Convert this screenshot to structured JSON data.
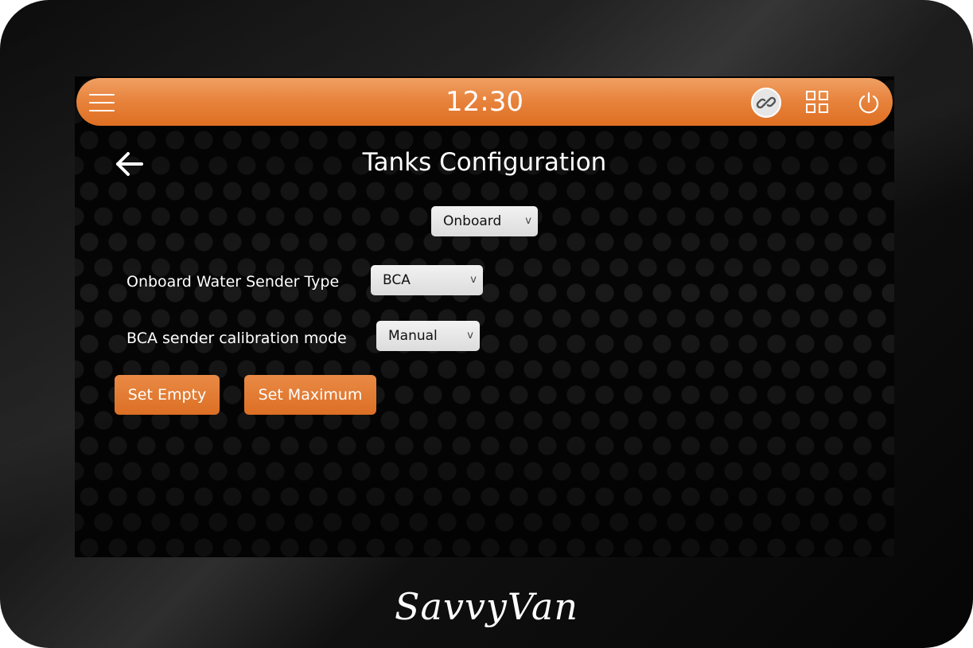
{
  "header": {
    "time": "12:30"
  },
  "page": {
    "title": "Tanks Configuration"
  },
  "tank_select": {
    "value": "Onboard"
  },
  "sender_type": {
    "label": "Onboard Water Sender Type",
    "value": "BCA"
  },
  "calibration_mode": {
    "label": "BCA sender calibration mode",
    "value": "Manual"
  },
  "buttons": {
    "set_empty": "Set Empty",
    "set_maximum": "Set Maximum"
  },
  "select_chevron": "v",
  "brand": {
    "logo": "SavvyVan",
    "accent_color": "#e37a33"
  },
  "icons": {
    "menu": "menu-icon",
    "link": "link-icon",
    "grid": "grid-icon",
    "power": "power-icon",
    "back": "arrow-left-icon"
  }
}
